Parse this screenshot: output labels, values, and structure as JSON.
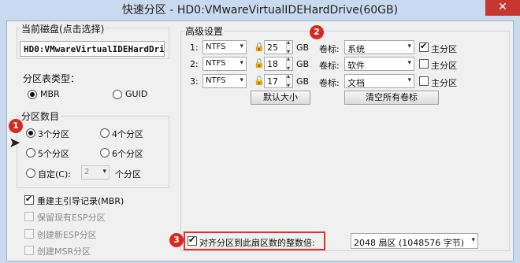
{
  "window": {
    "title": "快速分区 - HD0:VMwareVirtualIDEHardDrive(60GB)",
    "close": "✕"
  },
  "disk": {
    "group_title": "当前磁盘(点击选择)",
    "value": "HD0:VMwareVirtualIDEHardDri"
  },
  "partition_table": {
    "label": "分区表类型：",
    "mbr": "MBR",
    "guid": "GUID",
    "selected": "MBR"
  },
  "partition_count": {
    "group_title": "分区数目",
    "options": [
      "3个分区",
      "4个分区",
      "5个分区",
      "6个分区"
    ],
    "custom_label": "自定(C):",
    "custom_value": "2",
    "custom_suffix": "个分区",
    "selected": "3个分区"
  },
  "options": {
    "rebuild_mbr": "重建主引导记录(MBR)",
    "keep_esp": "保留现有ESP分区",
    "create_esp": "创建新ESP分区",
    "create_msr": "创建MSR分区"
  },
  "advanced": {
    "group_title": "高级设置",
    "rows": [
      {
        "index": "1:",
        "fs": "NTFS",
        "size": "25",
        "unit": "GB",
        "label_caption": "卷标:",
        "label_value": "系统",
        "primary": "主分区",
        "primary_checked": true
      },
      {
        "index": "2:",
        "fs": "NTFS",
        "size": "18",
        "unit": "GB",
        "label_caption": "卷标:",
        "label_value": "软件",
        "primary": "主分区",
        "primary_checked": false
      },
      {
        "index": "3:",
        "fs": "NTFS",
        "size": "17",
        "unit": "GB",
        "label_caption": "卷标:",
        "label_value": "文档",
        "primary": "主分区",
        "primary_checked": false
      }
    ],
    "default_size_button": "默认大小",
    "clear_labels_button": "清空所有卷标"
  },
  "align": {
    "label": "对齐分区到此扇区数的整数倍:",
    "value": "2048 扇区 (1048576 字节)"
  },
  "badges": [
    "1",
    "2",
    "3"
  ],
  "colors": {
    "accent": "#e03226",
    "title_bar": "#c9daf0",
    "close": "#c7372f"
  }
}
